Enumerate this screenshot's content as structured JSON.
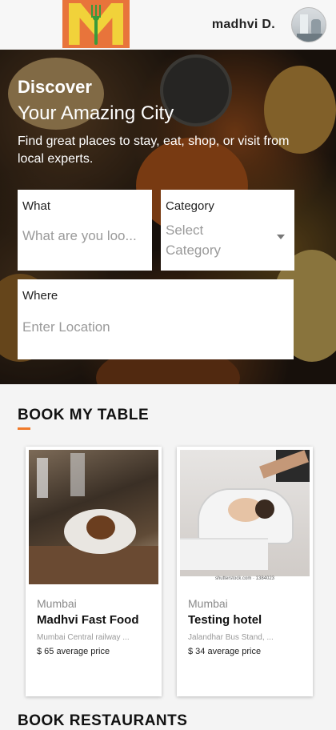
{
  "header": {
    "logo_letter": "M",
    "user_name": "madhvi D."
  },
  "hero": {
    "title_line1": "Discover",
    "title_line2": "Your Amazing City",
    "subtitle": "Find great places to stay, eat, shop, or visit from local experts.",
    "what": {
      "label": "What",
      "placeholder": "What are you loo..."
    },
    "category": {
      "label": "Category",
      "selected": "Select Category"
    },
    "where": {
      "label": "Where",
      "placeholder": "Enter Location"
    }
  },
  "section": {
    "title": "BOOK MY TABLE",
    "accent_color": "#f07a2a"
  },
  "cards": [
    {
      "city": "Mumbai",
      "name": "Madhvi Fast Food",
      "address": "Mumbai Central railway ...",
      "price": "$ 65 average price"
    },
    {
      "city": "Mumbai",
      "name": "Testing hotel",
      "address": "Jalandhar Bus Stand, ...",
      "price": "$ 34 average price",
      "image_caption": "shutterstock.com · 1384023"
    }
  ],
  "next_section": {
    "title": "BOOK RESTAURANTS"
  }
}
